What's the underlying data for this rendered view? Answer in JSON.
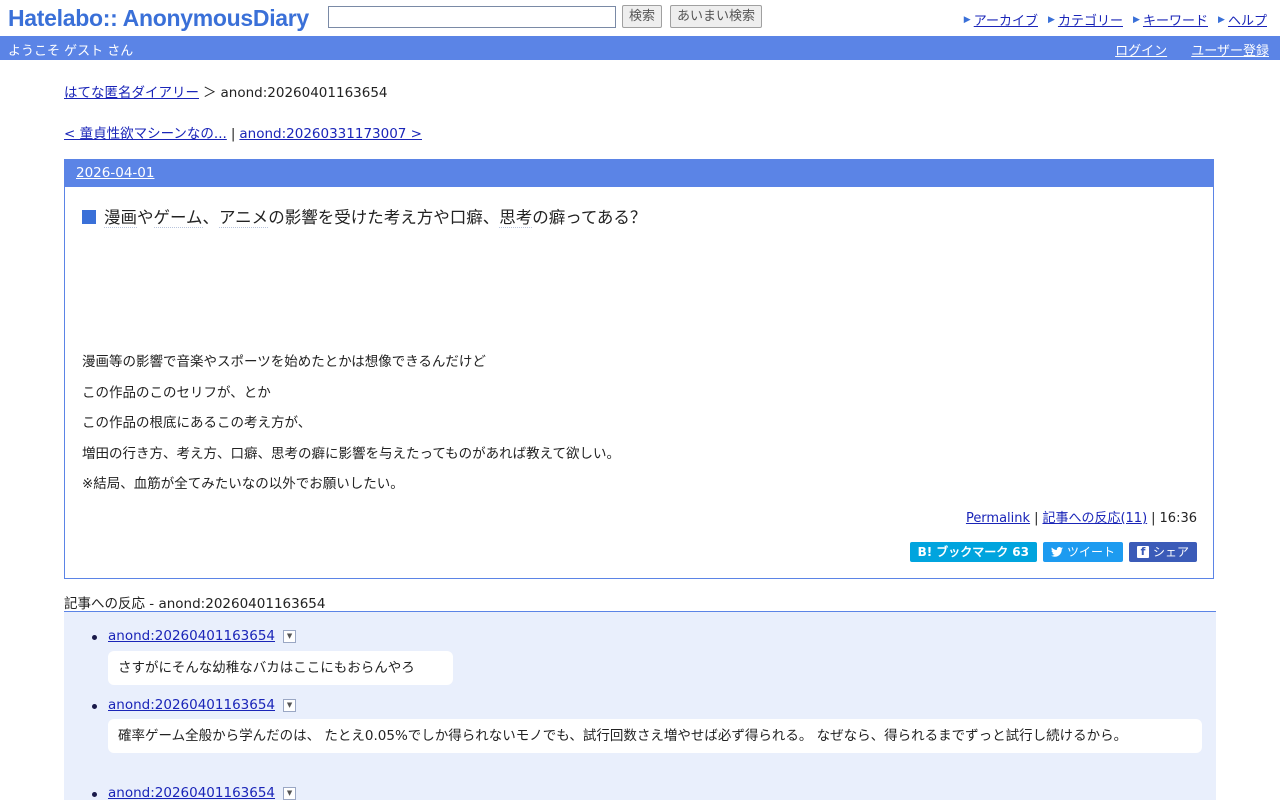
{
  "header": {
    "logo": "Hatelabo:: AnonymousDiary",
    "search_value": "",
    "search_placeholder": "",
    "search_button": "検索",
    "fuzzy_search_button": "あいまい検索",
    "nav": [
      "アーカイブ",
      "カテゴリー",
      "キーワード",
      "ヘルプ"
    ]
  },
  "welcome": {
    "message": "ようこそ ゲスト さん",
    "login": "ログイン",
    "register": "ユーザー登録"
  },
  "breadcrumb": {
    "home": "はてな匿名ダイアリー",
    "separator": "＞",
    "current": "anond:20260401163654"
  },
  "pager": {
    "prev": "< 童貞性欲マシーンなの...",
    "divider": "|",
    "next": "anond:20260331173007 >"
  },
  "entry": {
    "date": "2026-04-01",
    "title_parts": [
      "漫画",
      "や",
      "ゲーム",
      "、",
      "アニメ",
      "の影響を受けた考え方や口癖、",
      "思考",
      "の癖ってある？"
    ],
    "body": [
      "漫画等の影響で音楽やスポーツを始めたとかは想像できるんだけど",
      "この作品のこのセリフが、とか",
      "この作品の根底にあるこの考え方が、",
      "増田の行き方、考え方、口癖、思考の癖に影響を与えたってものがあれば教えて欲しい。",
      "※結局、血筋が全てみたいなの以外でお願いしたい。"
    ],
    "permalink": "Permalink",
    "reactions_link": "記事への反応(11)",
    "time": "16:36",
    "share": {
      "bookmark": "ブックマーク",
      "bookmark_count": "63",
      "tweet": "ツイート",
      "facebook": "シェア"
    }
  },
  "reactions": {
    "header_label": "記事への反応 -",
    "header_id": "anond:20260401163654",
    "items": [
      {
        "id": "anond:20260401163654",
        "text": "さすがにそんな幼稚なバカはここにもおらんやろ"
      },
      {
        "id": "anond:20260401163654",
        "text": "確率ゲーム全般から学んだのは、 たとえ0.05%でしか得られないモノでも、試行回数さえ増やせば必ず得られる。 なぜなら、得られるまでずっと試行し続けるから。"
      },
      {
        "id": "anond:20260401163654",
        "text": ""
      }
    ]
  },
  "colors": {
    "accent": "#5b84e6",
    "logo": "#3a70d8",
    "link": "#1a25b8",
    "reactions_bg": "#e9effc"
  }
}
